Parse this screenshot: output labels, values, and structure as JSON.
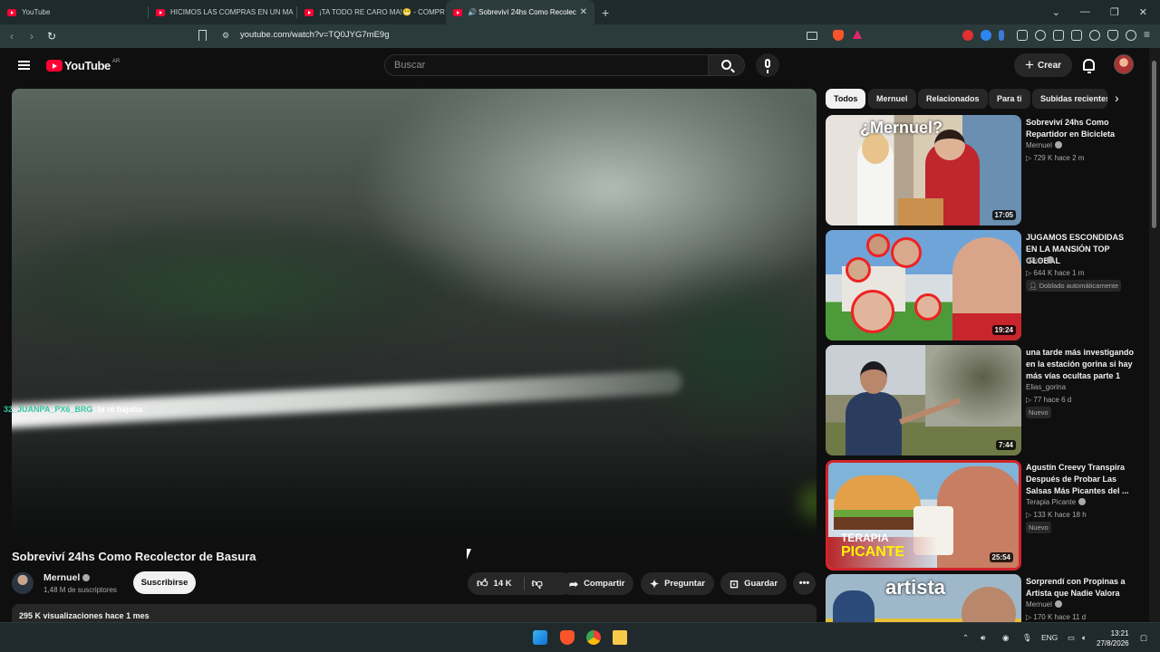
{
  "browser": {
    "tabs": [
      {
        "label": "YouTube"
      },
      {
        "label": "HICIMOS LAS COMPRAS EN UN MA"
      },
      {
        "label": "¡TA TODO RE CARO MA!😬 - COMPR"
      },
      {
        "label": "🔊 Sobreviví 24hs Como Recolec"
      }
    ],
    "url": "youtube.com/watch?v=TQ0JYG7mE9g"
  },
  "header": {
    "logo_text": "YouTube",
    "country_code": "AR",
    "search_placeholder": "Buscar",
    "create_label": "Crear"
  },
  "player": {
    "chat_user": "32_JUANPA_PX6_BRG",
    "chat_message": ": la re bajaba"
  },
  "video": {
    "title": "Sobreviví 24hs Como Recolector de Basura",
    "channel": "Mernuel",
    "subscribers": "1,48 M de suscriptores",
    "subscribe_label": "Suscribirse",
    "likes": "14 K",
    "share_label": "Compartir",
    "ask_label": "Preguntar",
    "save_label": "Guardar",
    "more_label": "•••",
    "views_line": "295 K visualizaciones  hace 1 mes"
  },
  "chips": [
    "Todos",
    "Mernuel",
    "Relacionados",
    "Para ti",
    "Subidas recientes"
  ],
  "recommendations": [
    {
      "title": "Sobreviví 24hs Como Repartidor en Bicicleta",
      "channel": "Mernuel",
      "meta": "▷ 729 K   hace 2 m",
      "duration": "17:05",
      "thumb_text": "¿Mernuel?"
    },
    {
      "title": "JUGAMOS ESCONDIDAS EN LA MANSIÓN TOP GLOBAL",
      "channel": "c0ker",
      "meta": "▷ 644 K   hace 1 m",
      "duration": "19:24",
      "badge": "Doblado automáticamente"
    },
    {
      "title": "una tarde más investigando en la estación gorina si hay más vías ocultas parte 1",
      "channel": "Elias_gorina",
      "meta": "▷ 77   hace 6 d",
      "duration": "7:44",
      "badge": "Nuevo"
    },
    {
      "title": "Agustín Creevy Transpira Después de Probar Las Salsas Más Picantes del ...",
      "channel": "Terapia Picante",
      "meta": "▷ 133 K   hace 18 h",
      "duration": "25:54",
      "badge": "Nuevo",
      "thumb_text": "TERAPIA",
      "thumb_text2": "PICANTE"
    },
    {
      "title": "Sorprendí con Propinas a Artista que Nadie Valora",
      "channel": "Mernuel",
      "meta": "▷ 170 K   hace 11 d",
      "thumb_text": "artista"
    }
  ],
  "taskbar": {
    "lang": "ENG",
    "time": "13:21",
    "date": "27/8/2026"
  }
}
